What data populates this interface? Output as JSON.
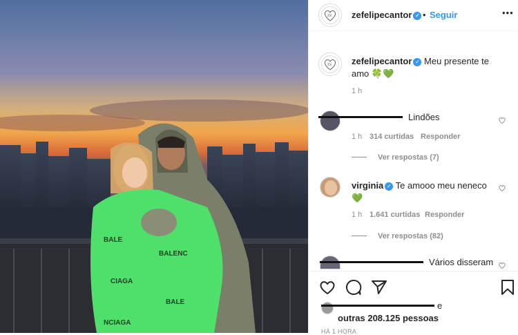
{
  "post": {
    "photo_alt": "",
    "author": "zefelipecantor",
    "follow": "Seguir",
    "more": "•••"
  },
  "caption": {
    "username": "zefelipecantor",
    "text": "Meu presente te amo 🍀💚",
    "time": "1 h"
  },
  "comments": [
    {
      "text": "Lindões",
      "time": "1 h",
      "likes": "314 curtidas",
      "reply": "Responder",
      "view_replies": "Ver respostas (7)"
    },
    {
      "username": "virginia",
      "text": "Te amooo meu neneco 💚",
      "time": "1 h",
      "likes": "1.641 curtidas",
      "reply": "Responder",
      "view_replies": "Ver respostas (82)"
    },
    {
      "text": "Vários disseram"
    }
  ],
  "likes_summary": {
    "line1_suffix": "e",
    "line2": "outras 208.125 pessoas"
  },
  "timestamp": "HÁ 1 HORA",
  "colors": {
    "accent": "#3897f0",
    "text": "#262626",
    "muted": "#8e8e8e"
  }
}
